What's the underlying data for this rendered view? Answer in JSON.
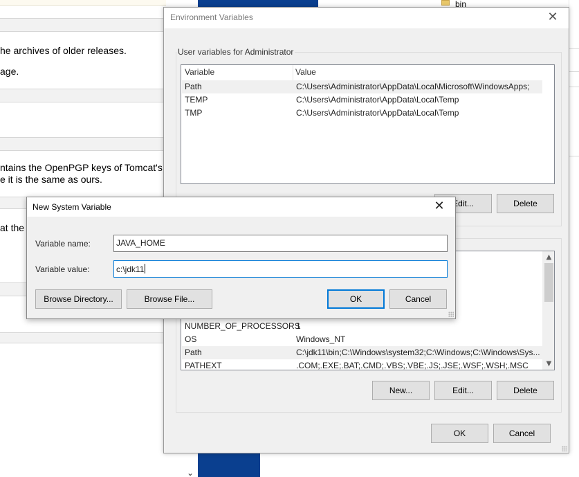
{
  "background_page": {
    "lines": [
      "he archives of older releases.",
      "age.",
      "ntains the OpenPGP keys of Tomcat's",
      "e it is the same as ours.",
      "at the"
    ]
  },
  "explorer": {
    "folder_label": "bin"
  },
  "env_dialog": {
    "title": "Environment Variables",
    "close_glyph": "✕",
    "user_group_label": "User variables for Administrator",
    "columns": [
      "Variable",
      "Value"
    ],
    "user_vars": [
      {
        "name": "Path",
        "value": "C:\\Users\\Administrator\\AppData\\Local\\Microsoft\\WindowsApps;"
      },
      {
        "name": "TEMP",
        "value": "C:\\Users\\Administrator\\AppData\\Local\\Temp"
      },
      {
        "name": "TMP",
        "value": "C:\\Users\\Administrator\\AppData\\Local\\Temp"
      }
    ],
    "user_buttons": {
      "edit": "Edit...",
      "delete": "Delete"
    },
    "system_vars": [
      {
        "name": "NUMBER_OF_PROCESSORS",
        "value": "1"
      },
      {
        "name": "OS",
        "value": "Windows_NT"
      },
      {
        "name": "Path",
        "value": "C:\\jdk11\\bin;C:\\Windows\\system32;C:\\Windows;C:\\Windows\\Sys..."
      },
      {
        "name": "PATHEXT",
        "value": ".COM;.EXE;.BAT;.CMD;.VBS;.VBE;.JS;.JSE;.WSF;.WSH;.MSC"
      }
    ],
    "system_buttons": {
      "new": "New...",
      "edit": "Edit...",
      "delete": "Delete"
    },
    "ok_label": "OK",
    "cancel_label": "Cancel",
    "scroll_up_glyph": "▲",
    "scroll_down_glyph": "▼"
  },
  "new_var_dialog": {
    "title": "New System Variable",
    "close_glyph": "✕",
    "name_label": "Variable name:",
    "name_value": "JAVA_HOME",
    "value_label": "Variable value:",
    "value_value": "c:\\jdk11",
    "browse_dir_label": "Browse Directory...",
    "browse_file_label": "Browse File...",
    "ok_label": "OK",
    "cancel_label": "Cancel"
  },
  "colors": {
    "dialog_bg": "#f0f0f0",
    "focus_blue": "#0078d7",
    "desktop_blue": "#0a3f8f"
  }
}
